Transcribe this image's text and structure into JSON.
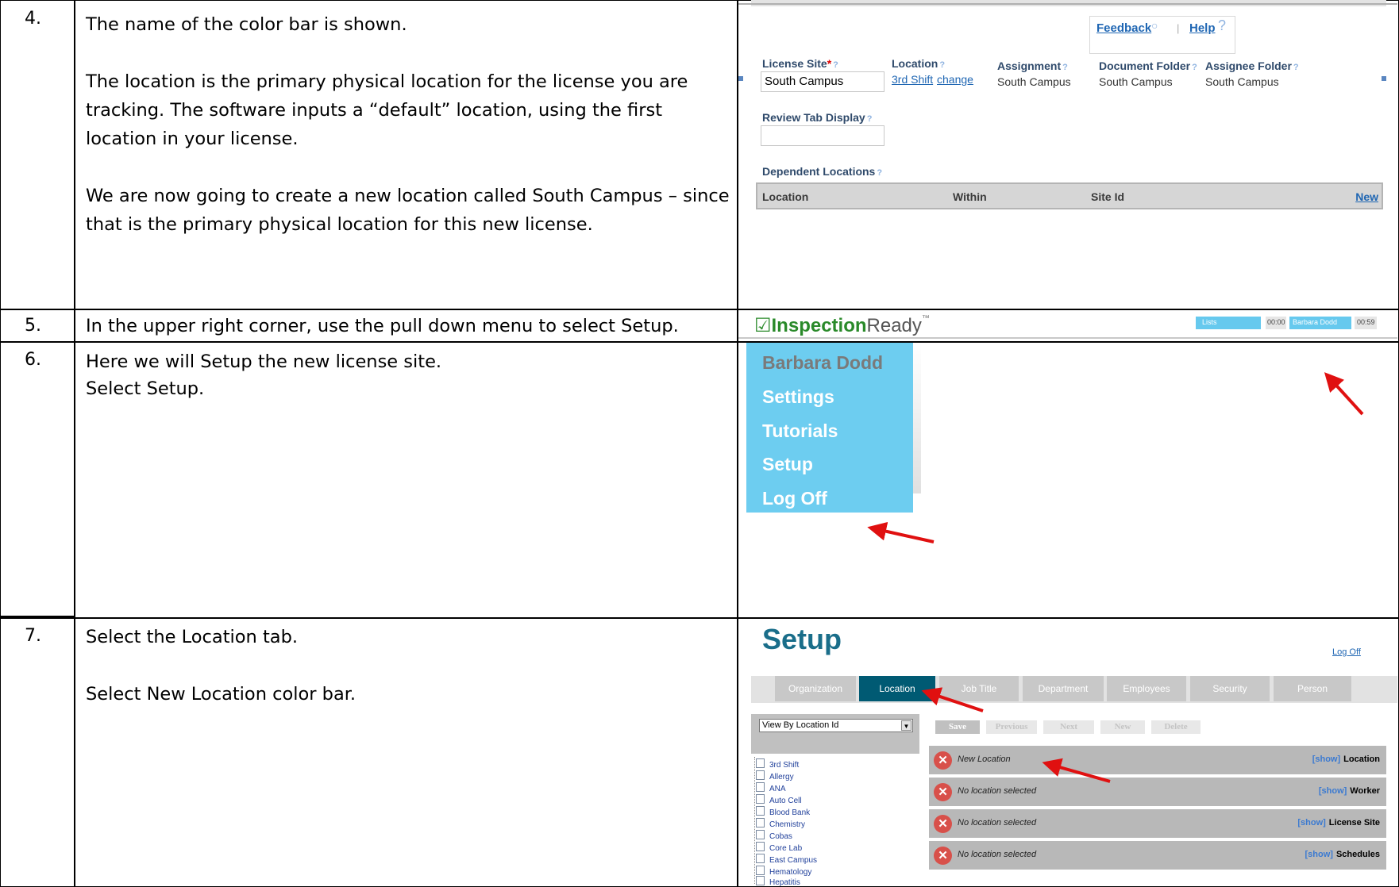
{
  "rows": [
    {
      "number": "4.",
      "paragraphs": [
        "The name of the color bar is shown.",
        "The location is the primary physical location for the license you are tracking.  The software inputs a “default” location, using the first location in your license.",
        "We are now going to create a new location called South Campus – since that is the primary physical location for this new license."
      ]
    },
    {
      "number": "5.",
      "paragraphs": [
        "In the upper right corner, use the pull down menu to select Setup."
      ]
    },
    {
      "number": "6.",
      "paragraphs": [
        "Here we will Setup the new license site.",
        "Select Setup."
      ]
    },
    {
      "number": "7.",
      "paragraphs": [
        "Select the Location tab.",
        "Select New Location color bar."
      ]
    }
  ],
  "license_panel": {
    "feedback": "Feedback",
    "separator": "|",
    "help": "Help",
    "help_icon": "?",
    "license_site_label": "License Site",
    "license_site_required": "*",
    "license_site_value": "South Campus",
    "location_label": "Location",
    "location_value": "3rd Shift",
    "location_change": "change",
    "assignment_label": "Assignment",
    "assignment_value": "South Campus",
    "document_folder_label": "Document Folder",
    "document_folder_value": "South Campus",
    "assignee_folder_label": "Assignee Folder",
    "assignee_folder_value": "South Campus",
    "review_tab_label": "Review Tab Display",
    "dependent_locations_label": "Dependent Locations",
    "table_headers": [
      "Location",
      "Within",
      "Site Id"
    ],
    "table_new": "New"
  },
  "header_panel": {
    "logo_check": "☑",
    "logo_bold": "Inspection",
    "logo_regular": "Ready",
    "logo_tm": "™",
    "lists": "Lists",
    "time1": "00:00",
    "user": "Barbara Dodd",
    "time2": "00:59"
  },
  "user_menu": {
    "items": [
      "Barbara Dodd",
      "Settings",
      "Tutorials",
      "Setup",
      "Log Off"
    ]
  },
  "setup_panel": {
    "title": "Setup",
    "log_off": "Log Off",
    "tabs": [
      "Organization",
      "Location",
      "Job Title",
      "Department",
      "Employees",
      "Security",
      "Person"
    ],
    "active_tab": "Location",
    "view_select": "View By Location Id",
    "buttons": [
      "Save",
      "Previous",
      "Next",
      "New",
      "Delete"
    ],
    "tree": [
      "3rd Shift",
      "Allergy",
      "ANA",
      "Auto Cell",
      "Blood Bank",
      "Chemistry",
      "Cobas",
      "Core Lab",
      "East Campus",
      "Hematology",
      "Hepatitis"
    ],
    "bars": [
      {
        "label": "New Location",
        "show": "[show]",
        "section": "Location"
      },
      {
        "label": "No location selected",
        "show": "[show]",
        "section": "Worker"
      },
      {
        "label": "No location selected",
        "show": "[show]",
        "section": "License Site"
      },
      {
        "label": "No location selected",
        "show": "[show]",
        "section": "Schedules"
      }
    ],
    "close_icon": "✕"
  },
  "colors": {
    "accent_blue": "#1f66b3",
    "menu_blue": "#6dcdf0",
    "active_tab": "#005a73",
    "arrow_red": "#e01010",
    "setup_title": "#1a6e8a"
  }
}
